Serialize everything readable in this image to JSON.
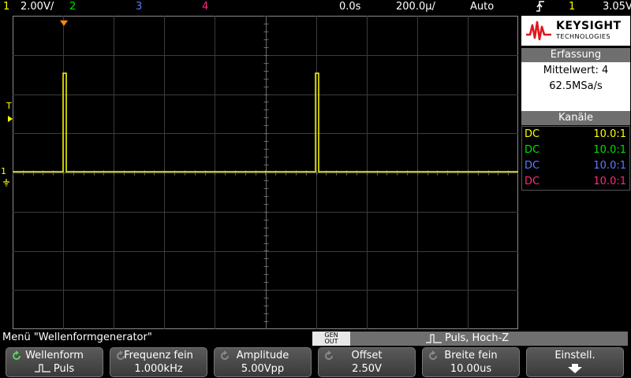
{
  "topbar": {
    "ch1_num": "1",
    "ch1_scale": "2.00V/",
    "ch2_num": "2",
    "ch3_num": "3",
    "ch4_num": "4",
    "delay": "0.0s",
    "timebase": "200.0µ/",
    "trigger_mode": "Auto",
    "trigger_icon": "trigger-edge-rising-icon",
    "trigger_ch": "1",
    "trigger_level": "3.05V"
  },
  "markers": {
    "trigger_level": "T",
    "ch1_ground": "1"
  },
  "logo": {
    "brand": "KEYSIGHT",
    "sub": "TECHNOLOGIES",
    "icon": "keysight-wave-logo"
  },
  "acquisition": {
    "title": "Erfassung",
    "mode": "Mittelwert: 4",
    "rate": "62.5MSa/s"
  },
  "channels": {
    "title": "Kanäle",
    "rows": [
      {
        "coupling": "DC",
        "probe": "10.0:1",
        "color": "#ffff00"
      },
      {
        "coupling": "DC",
        "probe": "10.0:1",
        "color": "#00e000"
      },
      {
        "coupling": "DC",
        "probe": "10.0:1",
        "color": "#5b7bff"
      },
      {
        "coupling": "DC",
        "probe": "10.0:1",
        "color": "#ff2a7f"
      }
    ]
  },
  "menu": {
    "title": "Menü \"Wellenformgenerator\"",
    "gen_out_1": "GEN",
    "gen_out_2": "OUT",
    "gen_status": "Puls, Hoch-Z"
  },
  "softkeys": [
    {
      "title": "Wellenform",
      "value": "Puls"
    },
    {
      "title": "Frequenz fein",
      "value": "1.000kHz"
    },
    {
      "title": "Amplitude",
      "value": "5.00Vpp"
    },
    {
      "title": "Offset",
      "value": "2.50V"
    },
    {
      "title": "Breite fein",
      "value": "10.00us"
    },
    {
      "title": "Einstell.",
      "value": ""
    }
  ],
  "colors": {
    "ch1": "#ffff00",
    "ch2": "#00e000",
    "ch3": "#5b7bff",
    "ch4": "#ff2a7f",
    "trigger_marker": "#ff8c00"
  }
}
